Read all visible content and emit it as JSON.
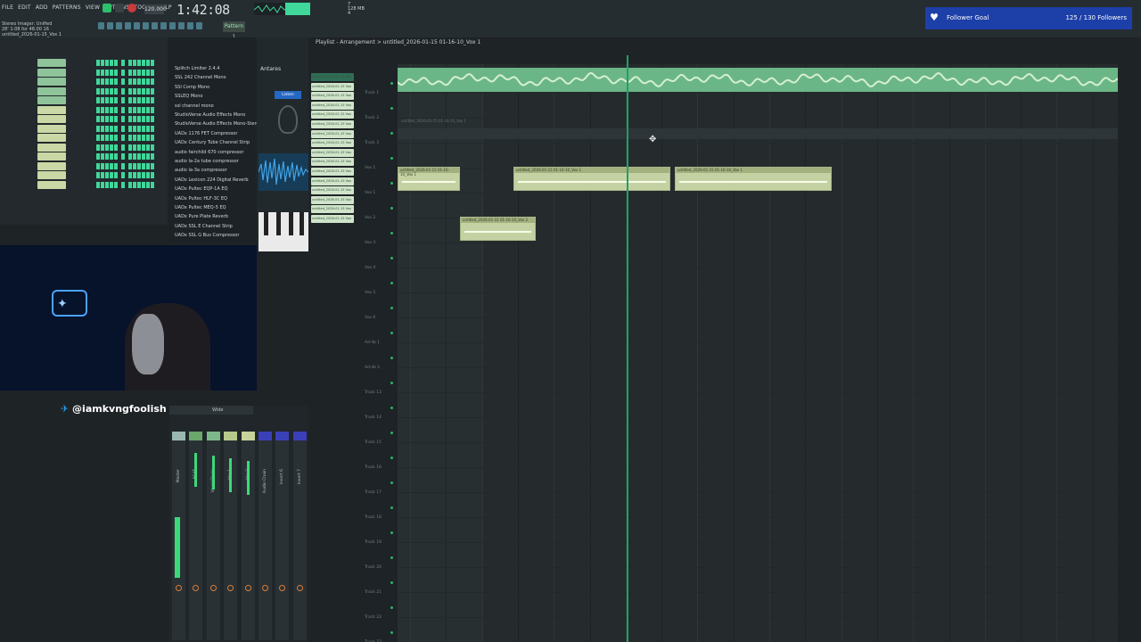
{
  "menu": {
    "items": [
      "FILE",
      "EDIT",
      "ADD",
      "PATTERNS",
      "VIEW",
      "OPTIONS",
      "TOOLS",
      "HELP"
    ]
  },
  "transport": {
    "tempo": "120.000",
    "clock": "1:42:08",
    "pattern_label": "Pattern 1",
    "cpu_top": "7",
    "cpu_mid": "128 MB",
    "cpu_bot": "4"
  },
  "hint": {
    "line1": "Stereo Imager: Unified",
    "line2": "28' 1:08 for 48.00 16",
    "line3": "untitled_2026-01-15_Vox 1"
  },
  "follower_goal": {
    "label": "Follower Goal",
    "progress": "125 / 130 Followers",
    "current": 125,
    "target": 130
  },
  "channel_rack": {
    "rows": 14
  },
  "plugins": [
    "Splitch Limiter 2.4.4",
    "SSL 242 Channel Mono",
    "SSI Comp Mono",
    "SSLEQ Mono",
    "ssl channel mono",
    "StudioVerse Audio Effects Mono",
    "StudioVerse Audio Effects Mono-Stereo",
    "UADx 1176 FET Compressor",
    "UADx Century Tube Channel Strip",
    "audio fairchild 670 compressor",
    "audio la-2a tube compressor",
    "audio la-3a compressor",
    "UADx Lexicon 224 Digital Reverb",
    "UADx Pultec EQP-1A EQ",
    "UADx Pultec HLF-3C EQ",
    "UADx Pultec MEQ-5 EQ",
    "UADx Pure Plate Reverb",
    "UADx SSL E Channel Strip",
    "UADx SSL G Bus Compressor"
  ],
  "browser": {
    "tab_label": "Antares",
    "button_label": "Listen"
  },
  "patterns": [
    "untitled_2026-01-15 Vox",
    "untitled_2026-01-15 Vox",
    "untitled_2026-01-15 Vox",
    "untitled_2026-01-15 Vox",
    "untitled_2026-01-15 Vox",
    "untitled_2026-01-15 Vox",
    "untitled_2026-01-15 Vox",
    "untitled_2026-01-15 Vox",
    "untitled_2026-01-15 Vox",
    "untitled_2026-01-15 Vox",
    "untitled_2026-01-15 Vox",
    "untitled_2026-01-15 Vox",
    "untitled_2026-01-15 Vox",
    "untitled_2026-01-15 Vox",
    "untitled_2026-01-15 Vox",
    "untitled_2026-01-15 Vox"
  ],
  "social": {
    "twitter_handle": "@iamkvngfoolish"
  },
  "mixer": {
    "header": "Wide",
    "strip_labels": [
      "Master",
      "BEAT",
      "Vocal Chain",
      "Vox 1",
      "Vox 2",
      "Audio Chain",
      "Insert 6",
      "Insert 7"
    ]
  },
  "playlist": {
    "title": "Playlist - Arrangement > untitled_2026-01-15 01-16-10_Vox 1",
    "tracks": [
      "Track 1",
      "Track 2",
      "Track 3",
      "Vox 1",
      "Vox 1",
      "Vox 2",
      "Vox 3",
      "Vox 4",
      "Vox 5",
      "Vox 6",
      "Ad-lib 1",
      "Ad-lib 2",
      "Track 13",
      "Track 14",
      "Track 15",
      "Track 16",
      "Track 17",
      "Track 18",
      "Track 19",
      "Track 20",
      "Track 21",
      "Track 22",
      "Track 23"
    ],
    "clips": [
      {
        "label": "untitled_2026-01-15 01-16-10_Vox 1"
      },
      {
        "label": "untitled_2026-01-15 01-16-10_Vox 1"
      },
      {
        "label": "untitled_2026-01-15 01-16-10_Vox 1"
      },
      {
        "label": "untitled_2026-01-15 01-16-10_Vox 2"
      }
    ],
    "lane3_label": "untitled_2026-01-15 01-16-10_Vox 1"
  },
  "colors": {
    "accent_green": "#3fd79a",
    "playhead": "#1fa069",
    "follower_bg": "#1d3fa8",
    "clip": "#c4d2a3",
    "adlib_bg": "#3a3fbb"
  }
}
